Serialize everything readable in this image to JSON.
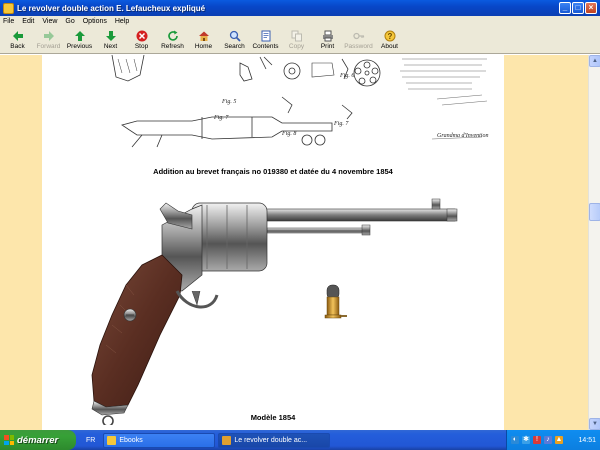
{
  "window": {
    "title": "Le revolver double action E. Lefaucheux expliqué",
    "buttons": {
      "minimize": "_",
      "maximize": "□",
      "close": "×"
    }
  },
  "menu": [
    "File",
    "Edit",
    "View",
    "Go",
    "Options",
    "Help"
  ],
  "toolbar": [
    {
      "label": "Back",
      "icon": "back-arrow-icon",
      "color": "#1a9a3a",
      "enabled": true
    },
    {
      "label": "Forward",
      "icon": "forward-arrow-icon",
      "color": "#1a9a3a",
      "enabled": false
    },
    {
      "label": "Previous",
      "icon": "up-arrow-icon",
      "color": "#1a9a3a",
      "enabled": true
    },
    {
      "label": "Next",
      "icon": "down-arrow-icon",
      "color": "#1a9a3a",
      "enabled": true
    },
    {
      "label": "Stop",
      "icon": "stop-icon",
      "color": "#d42020",
      "enabled": true
    },
    {
      "label": "Refresh",
      "icon": "refresh-icon",
      "color": "#1a9a3a",
      "enabled": true
    },
    {
      "label": "Home",
      "icon": "home-icon",
      "color": "#c8781e",
      "enabled": true
    },
    {
      "label": "Search",
      "icon": "search-icon",
      "color": "#3a5fb0",
      "enabled": true
    },
    {
      "label": "Contents",
      "icon": "contents-icon",
      "color": "#3a5fb0",
      "enabled": true
    },
    {
      "label": "Copy",
      "icon": "copy-icon",
      "color": "#7a7a7a",
      "enabled": false
    },
    {
      "label": "Print",
      "icon": "print-icon",
      "color": "#5a5a5a",
      "enabled": true
    },
    {
      "label": "Password",
      "icon": "key-icon",
      "color": "#7a7a7a",
      "enabled": false
    },
    {
      "label": "About",
      "icon": "about-icon",
      "color": "#c89a1e",
      "enabled": true
    }
  ],
  "content": {
    "patent_caption": "Addition au brevet français no 019380 et datée du 4 novembre 1854",
    "model_caption": "Modèle 1854",
    "page_bg": "#fde6ab"
  },
  "taskbar": {
    "start_label": "démarrer",
    "language": "FR",
    "tasks": [
      {
        "label": "Ebooks",
        "active": false
      },
      {
        "label": "Le revolver double ac...",
        "active": true
      }
    ],
    "clock": "14:51"
  }
}
